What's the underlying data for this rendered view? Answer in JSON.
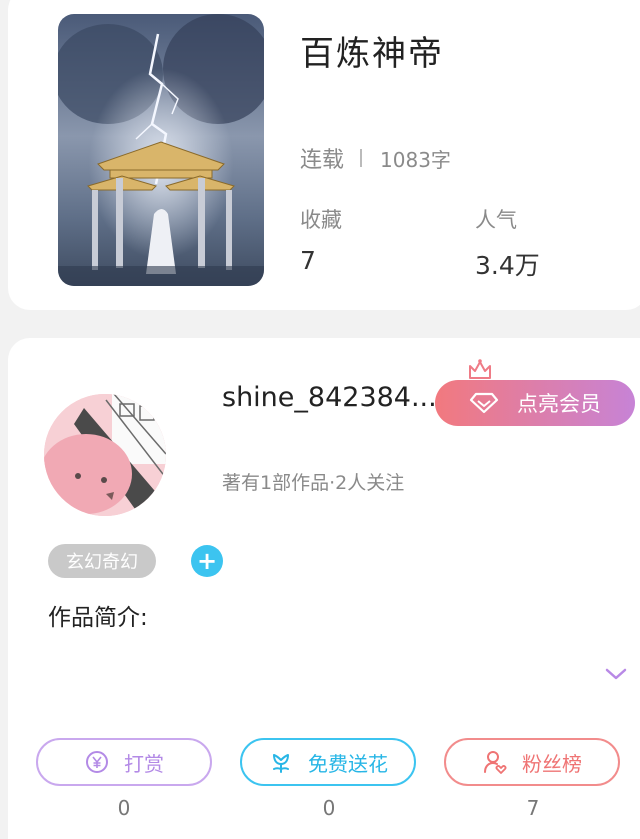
{
  "book": {
    "title": "百炼神帝",
    "status": "连载",
    "word_count": "1083字",
    "stats": [
      {
        "label": "收藏",
        "value": "7"
      },
      {
        "label": "人气",
        "value": "3.4万"
      }
    ]
  },
  "author": {
    "name": "shine_842384...",
    "meta": "著有1部作品·2人关注",
    "vip_label": "点亮会员"
  },
  "tags": [
    {
      "label": "玄幻奇幻"
    }
  ],
  "intro_label": "作品简介:",
  "actions": [
    {
      "label": "打赏",
      "count": "0",
      "color": "#b889e6",
      "icon": "yen-coin-icon"
    },
    {
      "label": "免费送花",
      "count": "0",
      "color": "#3cc4f0",
      "icon": "flower-icon"
    },
    {
      "label": "粉丝榜",
      "count": "7",
      "color": "#f07a7a",
      "icon": "fans-icon"
    }
  ],
  "colors": {
    "vip_gradient_start": "#f2797e",
    "vip_gradient_end": "#c783d6",
    "tag_add": "#3cc4f0",
    "expand_chevron": "#b889e6"
  }
}
